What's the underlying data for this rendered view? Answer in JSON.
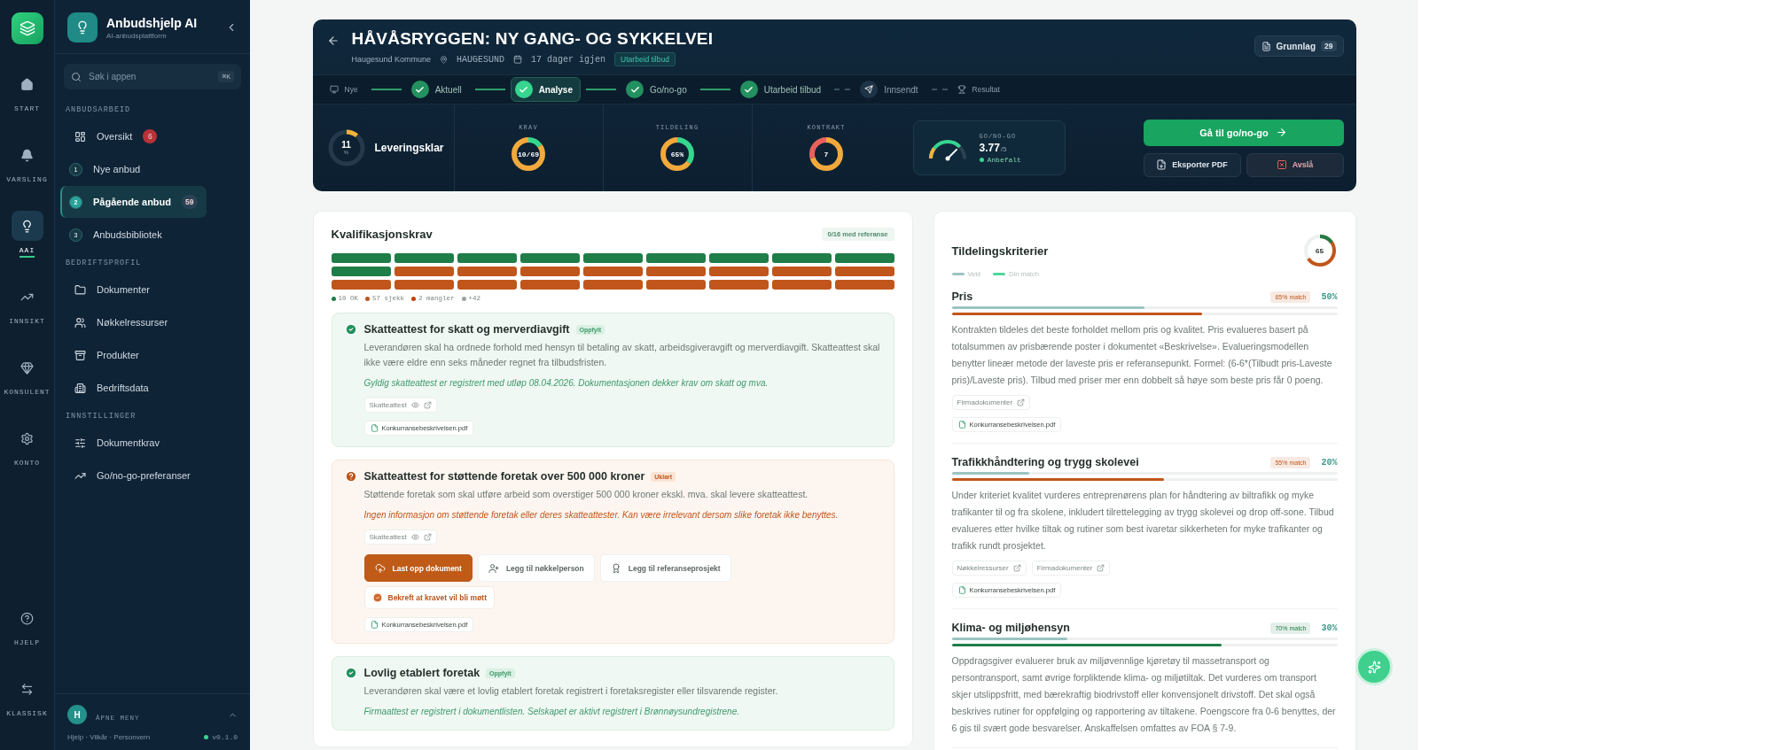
{
  "rail": {
    "items": [
      {
        "label": "START",
        "selected": false
      },
      {
        "label": "VARSLING",
        "selected": false
      },
      {
        "label": "AAI",
        "selected": true
      },
      {
        "label": "INNSIKT",
        "selected": false
      },
      {
        "label": "KONSULENT",
        "selected": false
      },
      {
        "label": "KONTO",
        "selected": false
      }
    ],
    "bottom": [
      {
        "label": "HJELP"
      },
      {
        "label": "KLASSISK"
      }
    ]
  },
  "sidebar": {
    "title": "Anbudshjelp AI",
    "subtitle": "AI-anbudsplattform",
    "search": {
      "placeholder": "Søk i appen",
      "shortcut": "⌘K"
    },
    "sections": [
      {
        "title": "ANBUDSARBEID",
        "items": [
          {
            "kind": "nav",
            "label": "Oversikt",
            "selected": false,
            "badge": {
              "text": "6",
              "color": "#b8323a"
            }
          },
          {
            "kind": "step",
            "step": "1",
            "label": "Nye anbud",
            "selected": false
          },
          {
            "kind": "step",
            "step": "2",
            "label": "Pågående anbud",
            "selected": true,
            "badge": {
              "text": "59",
              "color": "#2a4256"
            }
          },
          {
            "kind": "step",
            "step": "3",
            "label": "Anbudsbibliotek",
            "selected": false
          }
        ]
      },
      {
        "title": "BEDRIFTSPROFIL",
        "items": [
          {
            "kind": "nav",
            "label": "Dokumenter",
            "selected": false
          },
          {
            "kind": "nav",
            "label": "Nøkkelressurser",
            "selected": false
          },
          {
            "kind": "nav",
            "label": "Produkter",
            "selected": false
          },
          {
            "kind": "nav",
            "label": "Bedriftsdata",
            "selected": false
          }
        ]
      },
      {
        "title": "INNSTILLINGER",
        "items": [
          {
            "kind": "nav",
            "label": "Dokumentkrav",
            "selected": false
          },
          {
            "kind": "nav",
            "label": "Go/no-go-preferanser",
            "selected": false
          }
        ]
      }
    ],
    "user": {
      "initial": "H",
      "label": "ÅPNE MENY"
    },
    "footer": "Hjelp · Vilkår · Personvern",
    "version": "v0.1.0"
  },
  "header": {
    "title": "HÅVÅSRYGGEN: NY GANG- OG SYKKELVEI",
    "org": "Haugesund Kommune",
    "location": "HAUGESUND",
    "deadline": "17 dager igjen",
    "status": "Utarbeid tilbud",
    "basis": {
      "label": "Grunnlag",
      "count": "29"
    },
    "steps": [
      {
        "kind": "start",
        "label": "Nye",
        "done": false,
        "selected": false
      },
      {
        "kind": "step",
        "label": "Aktuell",
        "done": true,
        "selected": false
      },
      {
        "kind": "step",
        "label": "Analyse",
        "done": true,
        "selected": true
      },
      {
        "kind": "step",
        "label": "Go/no-go",
        "done": true,
        "selected": false
      },
      {
        "kind": "step",
        "label": "Utarbeid tilbud",
        "done": true,
        "selected": false
      },
      {
        "kind": "step",
        "label": "Innsendt",
        "done": false,
        "selected": false
      },
      {
        "kind": "end",
        "label": "Resultat",
        "done": false,
        "selected": false
      }
    ],
    "readiness": {
      "value": "11",
      "unit": "%",
      "label": "Leveringsklar",
      "level": 0.11
    },
    "metrics": [
      {
        "label": "KRAV",
        "value": "10/69",
        "segments": [
          {
            "color": "#36d68f",
            "level": 0.15
          },
          {
            "color": "#f2a93b",
            "level": 0.85
          }
        ]
      },
      {
        "label": "TILDELING",
        "value": "65%",
        "segments": [
          {
            "color": "#36d68f",
            "level": 0.35
          },
          {
            "color": "#f2a93b",
            "level": 0.65
          }
        ]
      },
      {
        "label": "KONTRAKT",
        "value": "7",
        "segments": [
          {
            "color": "#f2a93b",
            "level": 0.7
          },
          {
            "color": "#e8615a",
            "level": 0.3
          }
        ]
      }
    ],
    "gonogo": {
      "label": "GO/NO-GO",
      "score": "3.77",
      "max": "/5",
      "verdict": "Anbefalt",
      "level": 0.75
    },
    "actions": {
      "primary": "Gå til go/no-go",
      "export": "Eksporter PDF",
      "decline": "Avslå"
    }
  },
  "requirements": {
    "title": "Kvalifikasjonskrav",
    "badge": "0/16 med referanse",
    "cells": [
      {
        "color": "#1f7d47"
      },
      {
        "color": "#1f7d47"
      },
      {
        "color": "#1f7d47"
      },
      {
        "color": "#1f7d47"
      },
      {
        "color": "#1f7d47"
      },
      {
        "color": "#1f7d47"
      },
      {
        "color": "#1f7d47"
      },
      {
        "color": "#1f7d47"
      },
      {
        "color": "#1f7d47"
      },
      {
        "color": "#1f7d47"
      },
      {
        "color": "#c0561b"
      },
      {
        "color": "#c0561b"
      },
      {
        "color": "#c0561b"
      },
      {
        "color": "#c0561b"
      },
      {
        "color": "#c0561b"
      },
      {
        "color": "#c0561b"
      },
      {
        "color": "#c0561b"
      },
      {
        "color": "#c0561b"
      },
      {
        "color": "#c0561b"
      },
      {
        "color": "#c0561b"
      },
      {
        "color": "#c0561b"
      },
      {
        "color": "#c0561b"
      },
      {
        "color": "#c0561b"
      },
      {
        "color": "#c0561b"
      },
      {
        "color": "#c0561b"
      },
      {
        "color": "#c0561b"
      },
      {
        "color": "#c0561b"
      }
    ],
    "legend": [
      {
        "label": "10 OK",
        "color": "#1f7d47"
      },
      {
        "label": "57 sjekk",
        "color": "#c0561b"
      },
      {
        "label": "2 mangler",
        "color": "#c2410c"
      },
      {
        "label": "+42",
        "color": "#9aa3a0"
      }
    ],
    "items": [
      {
        "kind": "ok",
        "title": "Skatteattest for skatt og merverdiavgift",
        "badge": "Oppfylt",
        "description": "Leverandøren skal ha ordnede forhold med hensyn til betaling av skatt, arbeidsgiveravgift og merverdiavgift. Skatteattest skal ikke være eldre enn seks måneder regnet fra tilbudsfristen.",
        "note": "Gyldig skatteattest er registrert med utløp 08.04.2026. Dokumentasjonen dekker krav om skatt og mva.",
        "tags": [
          {
            "label": "Skatteattest",
            "preview": true
          }
        ],
        "file": "Konkurransebeskrivelsen.pdf"
      },
      {
        "kind": "unclear",
        "title": "Skatteattest for støttende foretak over 500 000 kroner",
        "badge": "Uklart",
        "description": "Støttende foretak som skal utføre arbeid som overstiger 500 000 kroner ekskl. mva. skal levere skatteattest.",
        "note": "Ingen informasjon om støttende foretak eller deres skatteattester. Kan være irrelevant dersom slike foretak ikke benyttes.",
        "tags": [
          {
            "label": "Skatteattest",
            "preview": true
          }
        ],
        "actions": [
          {
            "label": "Last opp dokument",
            "primary": true
          },
          {
            "label": "Legg til nøkkelperson",
            "primary": false
          },
          {
            "label": "Legg til referanseprosjekt",
            "primary": false
          }
        ],
        "confirm": "Bekreft at kravet vil bli møtt",
        "file": "Konkurransebeskrivelsen.pdf"
      },
      {
        "kind": "ok",
        "title": "Lovlig etablert foretak",
        "badge": "Oppfylt",
        "description": "Leverandøren skal være et lovlig etablert foretak registrert i foretaksregister eller tilsvarende register.",
        "note": "Firmaattest er registrert i dokumentlisten. Selskapet er aktivt registrert i Brønnøysundregistrene."
      }
    ]
  },
  "criteria": {
    "title": "Tildelingskriterier",
    "score": "65",
    "level": 0.65,
    "legend": [
      "Vekt",
      "Din match"
    ],
    "items": [
      {
        "title": "Pris",
        "match": {
          "label": "65% match",
          "level": 0.65,
          "color": "#c0561b"
        },
        "weight": {
          "label": "50%",
          "level": 0.5
        },
        "description": "Kontrakten tildeles det beste forholdet mellom pris og kvalitet. Pris evalueres basert på totalsummen av prisbærende poster i dokumentet «Beskrivelse». Evalueringsmodellen benytter lineær metode der laveste pris er referansepunkt. Formel: (6-6*(Tilbudt pris-Laveste pris)/Laveste pris). Tilbud med priser mer enn dobbelt så høye som beste pris får 0 poeng.",
        "tags": [
          "Firmadokumenter"
        ],
        "file": "Konkurransebeskrivelsen.pdf"
      },
      {
        "title": "Trafikkhåndtering og trygg skolevei",
        "match": {
          "label": "55% match",
          "level": 0.55,
          "color": "#c0561b"
        },
        "weight": {
          "label": "20%",
          "level": 0.2
        },
        "description": "Under kriteriet kvalitet vurderes entreprenørens plan for håndtering av biltrafikk og myke trafikanter til og fra skolene, inkludert tilrettelegging av trygg skolevei og drop off-sone. Tilbud evalueres etter hvilke tiltak og rutiner som best ivaretar sikkerheten for myke trafikanter og trafikk rundt prosjektet.",
        "tags": [
          "Nøkkelressurser",
          "Firmadokumenter"
        ],
        "file": "Konkurransebeskrivelsen.pdf"
      },
      {
        "title": "Klima- og miljøhensyn",
        "match": {
          "label": "70% match",
          "level": 0.7,
          "color": "#1f7d47"
        },
        "weight": {
          "label": "30%",
          "level": 0.3
        },
        "description": "Oppdragsgiver evaluerer bruk av miljøvennlige kjøretøy til massetransport og persontransport, samt øvrige forpliktende klima- og miljøtiltak. Det vurderes om transport skjer utslippsfritt, med bærekraftig biodrivstoff eller konvensjonelt drivstoff. Det skal også beskrives rutiner for oppfølging og rapportering av tiltakene. Poengscore fra 0-6 benyttes, der 6 gis til svært gode besvarelser. Anskaffelsen omfattes av FOA § 7-9."
      }
    ]
  }
}
